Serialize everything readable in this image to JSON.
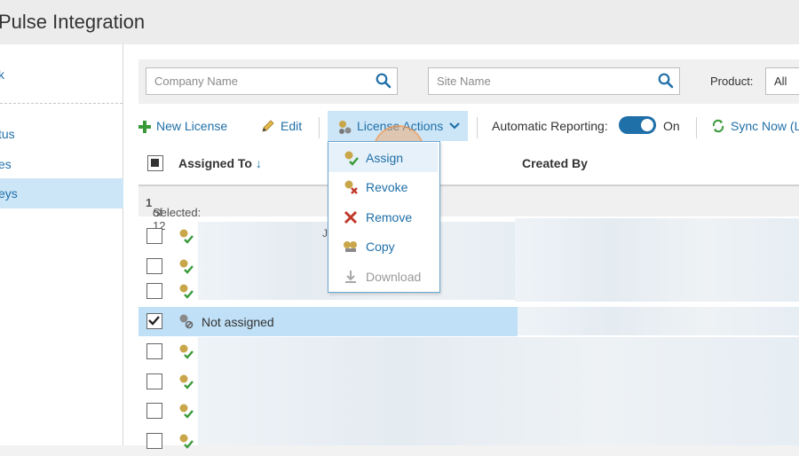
{
  "header": {
    "title": "Pulse Integration"
  },
  "sidebar": {
    "items": [
      {
        "label": "k",
        "active": false
      },
      {
        "label": "tus",
        "active": false
      },
      {
        "label": "es",
        "active": false
      },
      {
        "label": "eys",
        "active": true
      }
    ]
  },
  "filters": {
    "company_placeholder": "Company Name",
    "site_placeholder": "Site Name",
    "product_label": "Product:",
    "product_value": "All"
  },
  "toolbar": {
    "new_license": "New License",
    "edit": "Edit",
    "license_actions": "License Actions",
    "automatic_reporting": "Automatic Reporting:",
    "toggle_state": "On",
    "sync_now": "Sync Now (L"
  },
  "grid": {
    "col_assigned_to": "Assigned To",
    "col_created_by": "Created By",
    "selected_prefix": "Selected: ",
    "selected_count": "1",
    "selected_suffix": " of 12",
    "rows": [
      {
        "checked": false,
        "text": "",
        "icon": "license-assigned-icon"
      },
      {
        "checked": false,
        "text": "",
        "icon": "license-assigned-icon"
      },
      {
        "checked": false,
        "text": "",
        "icon": "license-assigned-icon"
      },
      {
        "checked": true,
        "text": "Not assigned",
        "icon": "license-unassigned-icon"
      },
      {
        "checked": false,
        "text": "",
        "icon": "license-assigned-icon"
      },
      {
        "checked": false,
        "text": "",
        "icon": "license-assigned-icon"
      },
      {
        "checked": false,
        "text": "",
        "icon": "license-assigned-icon"
      },
      {
        "checked": false,
        "text": "",
        "icon": "license-assigned-icon"
      }
    ],
    "row_fragment": "J"
  },
  "menu": {
    "items": [
      {
        "label": "Assign",
        "icon": "assign-icon",
        "enabled": true
      },
      {
        "label": "Revoke",
        "icon": "revoke-icon",
        "enabled": true
      },
      {
        "label": "Remove",
        "icon": "remove-x-icon",
        "enabled": true
      },
      {
        "label": "Copy",
        "icon": "copy-icon",
        "enabled": true
      },
      {
        "label": "Download",
        "icon": "download-icon",
        "enabled": false
      }
    ]
  },
  "colors": {
    "accent": "#1f6fa8",
    "selected_row": "#bfe0f6",
    "green": "#3a9a3a",
    "red": "#c0392b"
  }
}
